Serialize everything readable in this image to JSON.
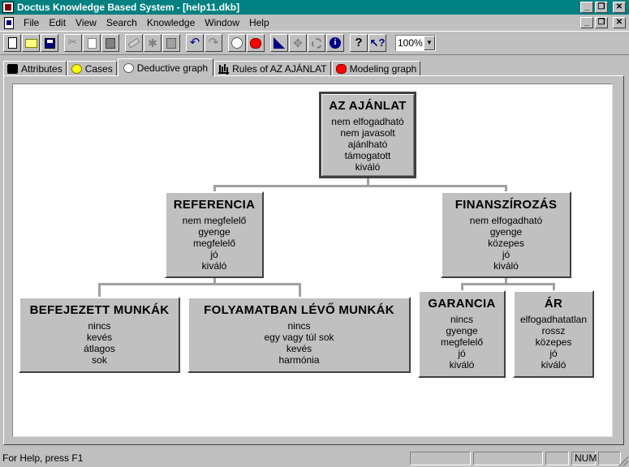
{
  "window": {
    "title": "Doctus Knowledge Based System - [help11.dkb]"
  },
  "menu": [
    {
      "label": "File",
      "name": "file"
    },
    {
      "label": "Edit",
      "name": "edit"
    },
    {
      "label": "View",
      "name": "view"
    },
    {
      "label": "Search",
      "name": "search"
    },
    {
      "label": "Knowledge",
      "name": "knowledge"
    },
    {
      "label": "Window",
      "name": "window"
    },
    {
      "label": "Help",
      "name": "help"
    }
  ],
  "toolbar": {
    "zoom": "100%",
    "icons": [
      "new-icon",
      "open-icon",
      "save-icon",
      "cut-icon",
      "copy-icon",
      "paste-icon",
      "eraser-icon",
      "asterisk-icon",
      "page-icon",
      "undo-icon",
      "redo-icon",
      "case-icon",
      "modeling-icon",
      "deductive-icon",
      "rule-icon",
      "move-icon",
      "gear-icon",
      "info-icon",
      "help-icon",
      "context-help-icon"
    ]
  },
  "tabs": [
    {
      "label": "Attributes",
      "icon": "attributes-icon",
      "active": false
    },
    {
      "label": "Cases",
      "icon": "cases-icon",
      "active": false
    },
    {
      "label": "Deductive graph",
      "icon": "deductive-graph-icon",
      "active": true
    },
    {
      "label": "Rules of AZ AJÁNLAT",
      "icon": "rules-icon",
      "active": false
    },
    {
      "label": "Modeling graph",
      "icon": "modeling-graph-icon",
      "active": false
    }
  ],
  "graph": {
    "root": {
      "title": "AZ AJÁNLAT",
      "values": [
        "nem elfogadható",
        "nem javasolt",
        "ajánlható",
        "támogatott",
        "kiváló"
      ]
    },
    "referencia": {
      "title": "REFERENCIA",
      "values": [
        "nem megfelelő",
        "gyenge",
        "megfelelő",
        "jó",
        "kiváló"
      ]
    },
    "finanszirozas": {
      "title": "FINANSZÍROZÁS",
      "values": [
        "nem elfogadható",
        "gyenge",
        "közepes",
        "jó",
        "kiváló"
      ]
    },
    "befejezett": {
      "title": "BEFEJEZETT MUNKÁK",
      "values": [
        "nincs",
        "kevés",
        "átlagos",
        "sok"
      ]
    },
    "folyamatban": {
      "title": "FOLYAMATBAN LÉVŐ MUNKÁK",
      "values": [
        "nincs",
        "egy vagy túl sok",
        "kevés",
        "harmónia"
      ]
    },
    "garancia": {
      "title": "GARANCIA",
      "values": [
        "nincs",
        "gyenge",
        "megfelelő",
        "jó",
        "kiváló"
      ]
    },
    "ar": {
      "title": "ÁR",
      "values": [
        "elfogadhatatlan",
        "rossz",
        "közepes",
        "jó",
        "kiváló"
      ]
    }
  },
  "status": {
    "help_text": "For Help, press F1",
    "num": "NUM"
  }
}
